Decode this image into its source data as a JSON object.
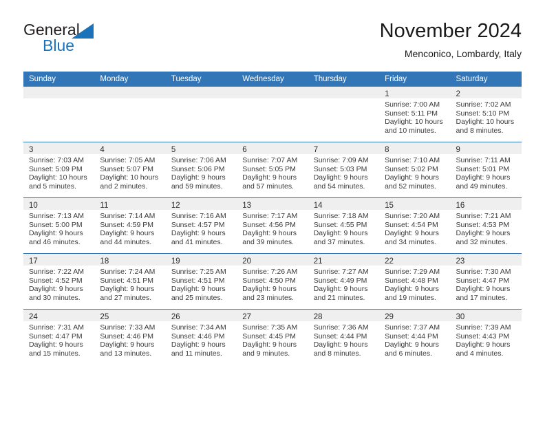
{
  "brand": {
    "name_part1": "General",
    "name_part2": "Blue",
    "triangle_color": "#1b72b8"
  },
  "header": {
    "month_title": "November 2024",
    "location": "Menconico, Lombardy, Italy"
  },
  "theme": {
    "header_blue": "#3276b8",
    "daynum_band": "#efefef",
    "text": "#3a3a3a"
  },
  "weekday_headers": [
    "Sunday",
    "Monday",
    "Tuesday",
    "Wednesday",
    "Thursday",
    "Friday",
    "Saturday"
  ],
  "weeks": [
    [
      {
        "day": "",
        "sunrise": "",
        "sunset": "",
        "daylight_line1": "",
        "daylight_line2": ""
      },
      {
        "day": "",
        "sunrise": "",
        "sunset": "",
        "daylight_line1": "",
        "daylight_line2": ""
      },
      {
        "day": "",
        "sunrise": "",
        "sunset": "",
        "daylight_line1": "",
        "daylight_line2": ""
      },
      {
        "day": "",
        "sunrise": "",
        "sunset": "",
        "daylight_line1": "",
        "daylight_line2": ""
      },
      {
        "day": "",
        "sunrise": "",
        "sunset": "",
        "daylight_line1": "",
        "daylight_line2": ""
      },
      {
        "day": "1",
        "sunrise": "Sunrise: 7:00 AM",
        "sunset": "Sunset: 5:11 PM",
        "daylight_line1": "Daylight: 10 hours",
        "daylight_line2": "and 10 minutes."
      },
      {
        "day": "2",
        "sunrise": "Sunrise: 7:02 AM",
        "sunset": "Sunset: 5:10 PM",
        "daylight_line1": "Daylight: 10 hours",
        "daylight_line2": "and 8 minutes."
      }
    ],
    [
      {
        "day": "3",
        "sunrise": "Sunrise: 7:03 AM",
        "sunset": "Sunset: 5:09 PM",
        "daylight_line1": "Daylight: 10 hours",
        "daylight_line2": "and 5 minutes."
      },
      {
        "day": "4",
        "sunrise": "Sunrise: 7:05 AM",
        "sunset": "Sunset: 5:07 PM",
        "daylight_line1": "Daylight: 10 hours",
        "daylight_line2": "and 2 minutes."
      },
      {
        "day": "5",
        "sunrise": "Sunrise: 7:06 AM",
        "sunset": "Sunset: 5:06 PM",
        "daylight_line1": "Daylight: 9 hours",
        "daylight_line2": "and 59 minutes."
      },
      {
        "day": "6",
        "sunrise": "Sunrise: 7:07 AM",
        "sunset": "Sunset: 5:05 PM",
        "daylight_line1": "Daylight: 9 hours",
        "daylight_line2": "and 57 minutes."
      },
      {
        "day": "7",
        "sunrise": "Sunrise: 7:09 AM",
        "sunset": "Sunset: 5:03 PM",
        "daylight_line1": "Daylight: 9 hours",
        "daylight_line2": "and 54 minutes."
      },
      {
        "day": "8",
        "sunrise": "Sunrise: 7:10 AM",
        "sunset": "Sunset: 5:02 PM",
        "daylight_line1": "Daylight: 9 hours",
        "daylight_line2": "and 52 minutes."
      },
      {
        "day": "9",
        "sunrise": "Sunrise: 7:11 AM",
        "sunset": "Sunset: 5:01 PM",
        "daylight_line1": "Daylight: 9 hours",
        "daylight_line2": "and 49 minutes."
      }
    ],
    [
      {
        "day": "10",
        "sunrise": "Sunrise: 7:13 AM",
        "sunset": "Sunset: 5:00 PM",
        "daylight_line1": "Daylight: 9 hours",
        "daylight_line2": "and 46 minutes."
      },
      {
        "day": "11",
        "sunrise": "Sunrise: 7:14 AM",
        "sunset": "Sunset: 4:59 PM",
        "daylight_line1": "Daylight: 9 hours",
        "daylight_line2": "and 44 minutes."
      },
      {
        "day": "12",
        "sunrise": "Sunrise: 7:16 AM",
        "sunset": "Sunset: 4:57 PM",
        "daylight_line1": "Daylight: 9 hours",
        "daylight_line2": "and 41 minutes."
      },
      {
        "day": "13",
        "sunrise": "Sunrise: 7:17 AM",
        "sunset": "Sunset: 4:56 PM",
        "daylight_line1": "Daylight: 9 hours",
        "daylight_line2": "and 39 minutes."
      },
      {
        "day": "14",
        "sunrise": "Sunrise: 7:18 AM",
        "sunset": "Sunset: 4:55 PM",
        "daylight_line1": "Daylight: 9 hours",
        "daylight_line2": "and 37 minutes."
      },
      {
        "day": "15",
        "sunrise": "Sunrise: 7:20 AM",
        "sunset": "Sunset: 4:54 PM",
        "daylight_line1": "Daylight: 9 hours",
        "daylight_line2": "and 34 minutes."
      },
      {
        "day": "16",
        "sunrise": "Sunrise: 7:21 AM",
        "sunset": "Sunset: 4:53 PM",
        "daylight_line1": "Daylight: 9 hours",
        "daylight_line2": "and 32 minutes."
      }
    ],
    [
      {
        "day": "17",
        "sunrise": "Sunrise: 7:22 AM",
        "sunset": "Sunset: 4:52 PM",
        "daylight_line1": "Daylight: 9 hours",
        "daylight_line2": "and 30 minutes."
      },
      {
        "day": "18",
        "sunrise": "Sunrise: 7:24 AM",
        "sunset": "Sunset: 4:51 PM",
        "daylight_line1": "Daylight: 9 hours",
        "daylight_line2": "and 27 minutes."
      },
      {
        "day": "19",
        "sunrise": "Sunrise: 7:25 AM",
        "sunset": "Sunset: 4:51 PM",
        "daylight_line1": "Daylight: 9 hours",
        "daylight_line2": "and 25 minutes."
      },
      {
        "day": "20",
        "sunrise": "Sunrise: 7:26 AM",
        "sunset": "Sunset: 4:50 PM",
        "daylight_line1": "Daylight: 9 hours",
        "daylight_line2": "and 23 minutes."
      },
      {
        "day": "21",
        "sunrise": "Sunrise: 7:27 AM",
        "sunset": "Sunset: 4:49 PM",
        "daylight_line1": "Daylight: 9 hours",
        "daylight_line2": "and 21 minutes."
      },
      {
        "day": "22",
        "sunrise": "Sunrise: 7:29 AM",
        "sunset": "Sunset: 4:48 PM",
        "daylight_line1": "Daylight: 9 hours",
        "daylight_line2": "and 19 minutes."
      },
      {
        "day": "23",
        "sunrise": "Sunrise: 7:30 AM",
        "sunset": "Sunset: 4:47 PM",
        "daylight_line1": "Daylight: 9 hours",
        "daylight_line2": "and 17 minutes."
      }
    ],
    [
      {
        "day": "24",
        "sunrise": "Sunrise: 7:31 AM",
        "sunset": "Sunset: 4:47 PM",
        "daylight_line1": "Daylight: 9 hours",
        "daylight_line2": "and 15 minutes."
      },
      {
        "day": "25",
        "sunrise": "Sunrise: 7:33 AM",
        "sunset": "Sunset: 4:46 PM",
        "daylight_line1": "Daylight: 9 hours",
        "daylight_line2": "and 13 minutes."
      },
      {
        "day": "26",
        "sunrise": "Sunrise: 7:34 AM",
        "sunset": "Sunset: 4:46 PM",
        "daylight_line1": "Daylight: 9 hours",
        "daylight_line2": "and 11 minutes."
      },
      {
        "day": "27",
        "sunrise": "Sunrise: 7:35 AM",
        "sunset": "Sunset: 4:45 PM",
        "daylight_line1": "Daylight: 9 hours",
        "daylight_line2": "and 9 minutes."
      },
      {
        "day": "28",
        "sunrise": "Sunrise: 7:36 AM",
        "sunset": "Sunset: 4:44 PM",
        "daylight_line1": "Daylight: 9 hours",
        "daylight_line2": "and 8 minutes."
      },
      {
        "day": "29",
        "sunrise": "Sunrise: 7:37 AM",
        "sunset": "Sunset: 4:44 PM",
        "daylight_line1": "Daylight: 9 hours",
        "daylight_line2": "and 6 minutes."
      },
      {
        "day": "30",
        "sunrise": "Sunrise: 7:39 AM",
        "sunset": "Sunset: 4:43 PM",
        "daylight_line1": "Daylight: 9 hours",
        "daylight_line2": "and 4 minutes."
      }
    ]
  ]
}
